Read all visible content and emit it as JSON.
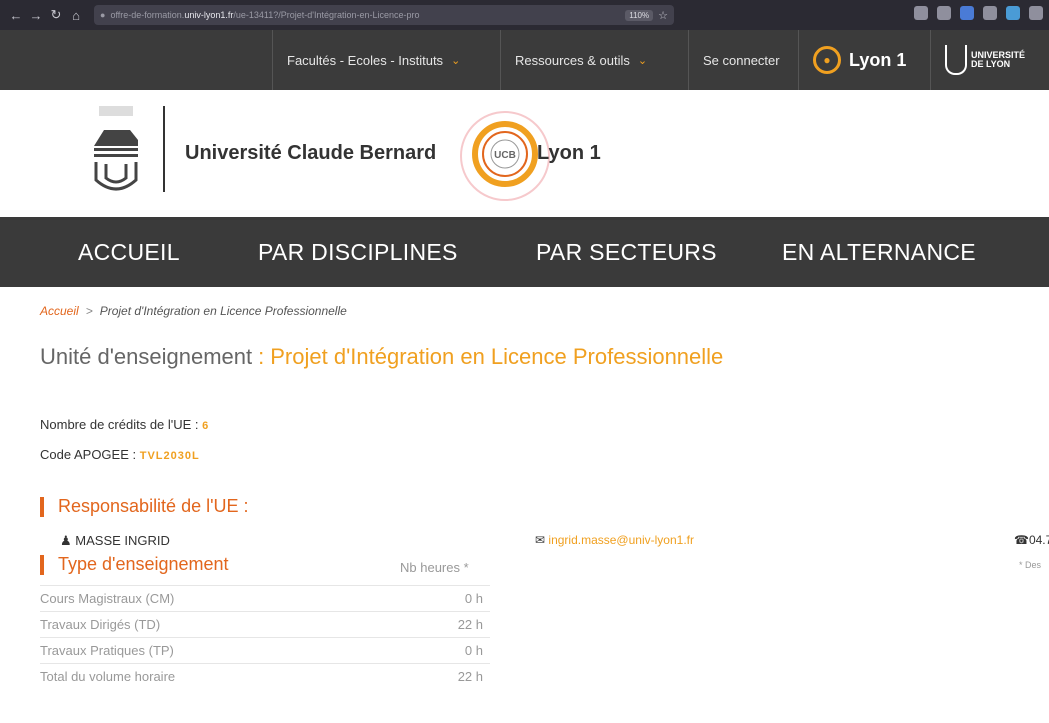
{
  "browser": {
    "url_prefix": "offre-de-formation.",
    "url_host": "univ-lyon1.fr",
    "url_rest": "/ue-13411?/Projet-d'Intégration-en-Licence-pro",
    "zoom": "110%"
  },
  "topnav": {
    "facultes": "Facultés - Ecoles - Instituts",
    "ressources": "Ressources & outils",
    "connect": "Se connecter",
    "lyon1": "Lyon 1",
    "udl_line1": "UNIVERSITÉ",
    "udl_line2": "DE LYON"
  },
  "header": {
    "uni_name": "Université Claude Bernard",
    "uni_lyon": "Lyon 1",
    "ring_text": "UCB"
  },
  "mainnav": {
    "items": [
      "ACCUEIL",
      "PAR DISCIPLINES",
      "PAR SECTEURS",
      "EN ALTERNANCE"
    ]
  },
  "breadcrumb": {
    "home": "Accueil",
    "sep": ">",
    "current": "Projet d'Intégration en Licence Professionnelle"
  },
  "title": {
    "prefix": "Unité d'enseignement",
    "colon": ":",
    "name": "Projet d'Intégration en Licence Professionnelle"
  },
  "ue": {
    "credits_label": "Nombre de crédits de l'UE :",
    "credits_value": "6",
    "apogee_label": "Code APOGEE :",
    "apogee_value": "TVL2030L"
  },
  "responsabilite": {
    "heading": "Responsabilité de l'UE :",
    "name": "MASSE INGRID",
    "email": "ingrid.masse@univ-lyon1.fr",
    "phone": "04.7"
  },
  "enseignement": {
    "heading": "Type d'enseignement",
    "hours_head": "Nb heures *",
    "note": "* Des",
    "rows": [
      {
        "label": "Cours Magistraux (CM)",
        "value": "0 h"
      },
      {
        "label": "Travaux Dirigés (TD)",
        "value": "22 h"
      },
      {
        "label": "Travaux Pratiques (TP)",
        "value": "0 h"
      },
      {
        "label": "Total du volume horaire",
        "value": "22 h"
      }
    ]
  },
  "colors": {
    "accent": "#f0a020",
    "accent_dark": "#e2661d",
    "nav_bg": "#3a3a3a"
  }
}
